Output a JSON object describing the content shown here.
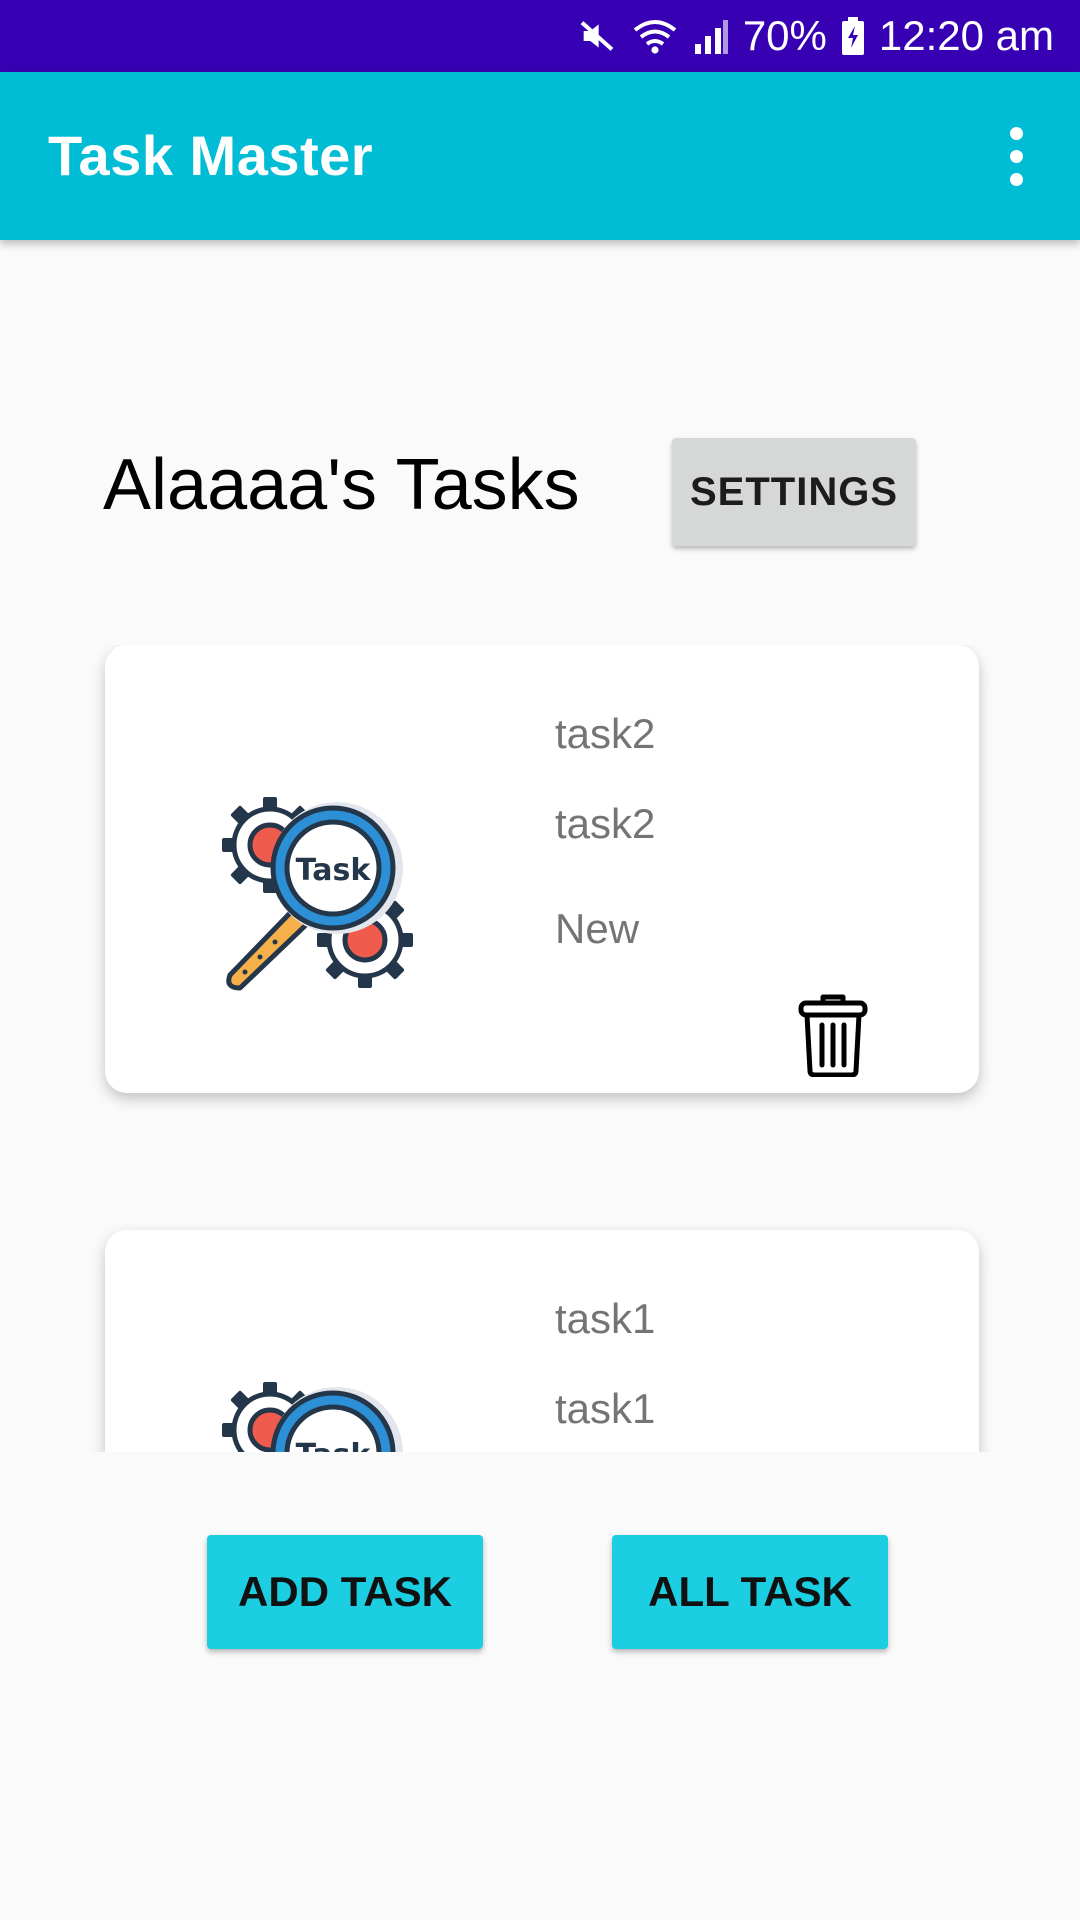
{
  "status_bar": {
    "battery": "70%",
    "time": "12:20 am",
    "icons": [
      "mute-icon",
      "wifi-icon",
      "signal-icon",
      "battery-charging-icon"
    ]
  },
  "app_bar": {
    "title": "Task Master",
    "menu_icon": "overflow-menu-icon"
  },
  "page": {
    "title": "Alaaaa's Tasks",
    "settings_label": "SETTINGS"
  },
  "tasks": [
    {
      "title": "task2",
      "body": "task2",
      "state": "New",
      "image_text": "Task"
    },
    {
      "title": "task1",
      "body": "task1",
      "image_text": "Task"
    }
  ],
  "actions": {
    "add_label": "ADD TASK",
    "all_label": "ALL TASK"
  },
  "colors": {
    "status_bar": "#3700b3",
    "app_bar": "#00bcd4",
    "action_button": "#1bcee2",
    "settings_button": "#d6d7d7"
  }
}
